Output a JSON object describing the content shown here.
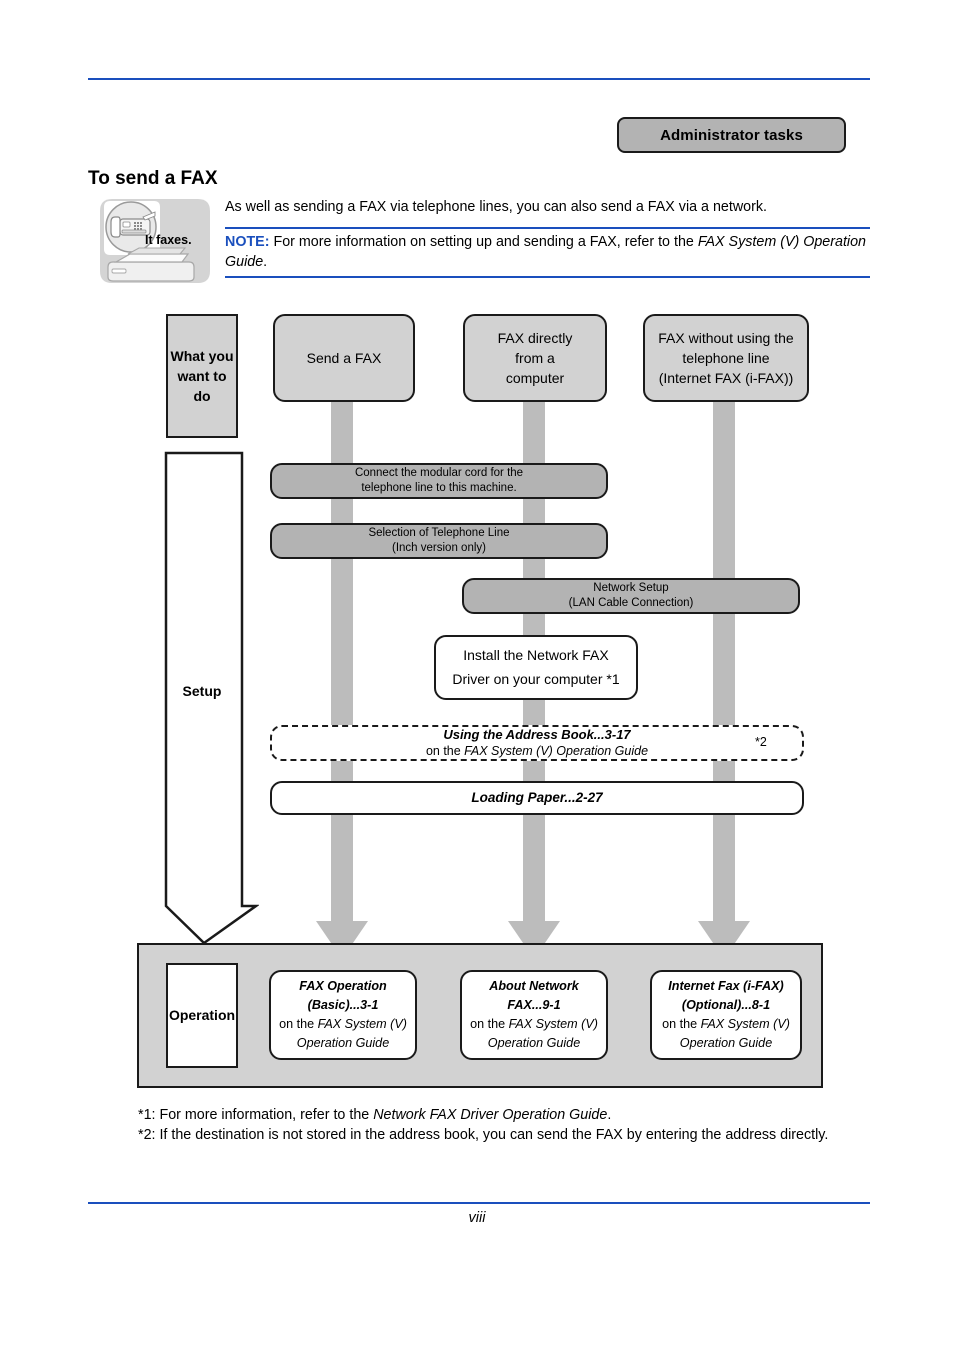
{
  "header": {
    "badge_label": "Administrator tasks",
    "title": "To send a FAX"
  },
  "icon": {
    "caption": "It faxes.",
    "name": "fax-machine-icon"
  },
  "intro": {
    "paragraph": "As well as sending a FAX via telephone lines, you can also send a FAX via a network.",
    "note_label": "NOTE:",
    "note_text_1": " For more information on setting up and sending a FAX, refer to the ",
    "note_italic_1": "FAX System (V) Operation Guide",
    "note_text_2": "."
  },
  "flow": {
    "row_labels": {
      "what": {
        "line1": "What",
        "line2": "you want",
        "line3": "to do"
      },
      "setup": "Setup",
      "operation": "Operation"
    },
    "goal_boxes": [
      {
        "lines": [
          "Send a FAX"
        ]
      },
      {
        "lines": [
          "FAX directly",
          "from a",
          "computer"
        ]
      },
      {
        "lines": [
          "FAX without using the",
          "telephone line",
          "(Internet FAX (i-FAX))"
        ]
      }
    ],
    "setup_steps": [
      {
        "lines": [
          "Connect the modular cord for the",
          "telephone line to this machine."
        ]
      },
      {
        "lines": [
          "Selection of Telephone Line",
          "(Inch version only)"
        ]
      },
      {
        "lines": [
          "Network Setup",
          "(LAN Cable Connection)"
        ]
      },
      {
        "lines": [
          "Install the Network FAX",
          "Driver on your computer  *1"
        ]
      }
    ],
    "address_book": {
      "title": "Using the Address Book...3-17",
      "sub_prefix": "on the ",
      "sub_italic": "FAX System (V) Operation Guide",
      "footnote_mark": "*2"
    },
    "loading_paper": {
      "title": "Loading Paper...2-27"
    },
    "operation_boxes": [
      {
        "title_line1": "FAX Operation",
        "title_line2": "(Basic)...3-1",
        "sub_prefix": "on the ",
        "sub_italic_line1": "FAX System (V)",
        "sub_italic_line2": "Operation Guide"
      },
      {
        "title_line1": "About Network",
        "title_line2": "FAX...9-1",
        "sub_prefix": "on the ",
        "sub_italic_line1": "FAX System (V)",
        "sub_italic_line2": "Operation Guide"
      },
      {
        "title_line1": "Internet Fax (i-FAX)",
        "title_line2": "(Optional)...8-1",
        "sub_prefix": "on the ",
        "sub_italic_line1": "FAX System (V)",
        "sub_italic_line2": "Operation Guide"
      }
    ]
  },
  "footnotes": {
    "fn1_prefix": "*1: For more information, refer to the ",
    "fn1_italic": "Network FAX Driver Operation Guide",
    "fn1_suffix": ".",
    "fn2": "*2: If the destination is not stored in the address book, you can send the FAX by entering the address directly."
  },
  "footer": {
    "page_number": "viii"
  },
  "colors": {
    "rule_blue": "#1a4fbd",
    "note_blue": "#1a4fbd",
    "box_gray": "#d2d2d2",
    "badge_gray": "#b3b3b3",
    "connector_gray": "#bcbcbc",
    "line_black": "#1a1a1a"
  }
}
